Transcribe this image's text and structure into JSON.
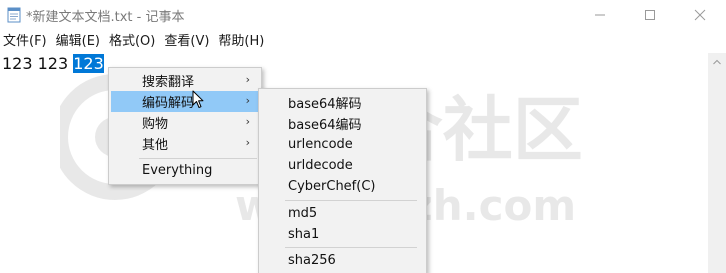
{
  "window": {
    "title": "*新建文本文档.txt - 记事本"
  },
  "titlebar_buttons": {
    "minimize_icon": "minimize-icon",
    "maximize_icon": "maximize-icon",
    "close_icon": "close-icon"
  },
  "menubar": {
    "items": [
      {
        "label": "文件(F)"
      },
      {
        "label": "编辑(E)"
      },
      {
        "label": "格式(O)"
      },
      {
        "label": "查看(V)"
      },
      {
        "label": "帮助(H)"
      }
    ]
  },
  "editor": {
    "text_before": "123 123 ",
    "text_selected": "123"
  },
  "context_menu": {
    "items": [
      {
        "label": "搜索翻译",
        "has_submenu": true
      },
      {
        "label": "编码解码",
        "has_submenu": true,
        "highlighted": true
      },
      {
        "label": "购物",
        "has_submenu": true
      },
      {
        "label": "其他",
        "has_submenu": true
      },
      {
        "label": "Everything",
        "has_submenu": false
      }
    ],
    "arrow_glyph": "›"
  },
  "submenu": {
    "items": [
      {
        "label": "base64解码"
      },
      {
        "label": "base64编码"
      },
      {
        "label": "urlencode"
      },
      {
        "label": "urldecode"
      },
      {
        "label": "CyberChef(C)"
      },
      {
        "label": "md5"
      },
      {
        "label": "sha1"
      },
      {
        "label": "sha256"
      }
    ]
  },
  "watermark": {
    "text": "i3综合社区",
    "url": "www.i3zh.com"
  },
  "colors": {
    "selection": "#0078d7",
    "menu_highlight": "#91c9f7",
    "menu_background": "#f2f2f2"
  }
}
